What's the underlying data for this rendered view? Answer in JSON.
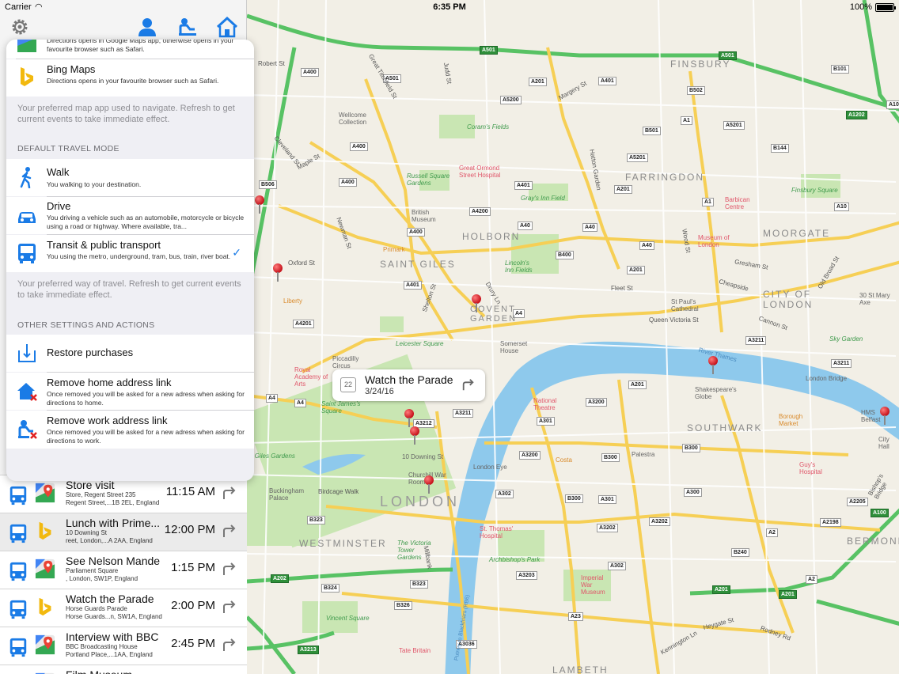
{
  "status": {
    "carrier": "Carrier",
    "time": "6:35 PM",
    "battery": "100%"
  },
  "toolbar": {
    "settings_icon": "gear-icon",
    "profile_icon": "person-icon",
    "work_icon": "person-desk-icon",
    "home_icon": "home-icon"
  },
  "popover": {
    "google_sub": "Directions opens in Google Maps app, otherwise opens in your favourite browser such as Safari.",
    "bing": {
      "title": "Bing Maps",
      "sub": "Directions opens in your favourite browser such as Safari."
    },
    "map_footer": "Your preferred map app used to navigate. Refresh to get current events to take immediate effect.",
    "travel_header": "DEFAULT TRAVEL MODE",
    "modes": [
      {
        "title": "Walk",
        "sub": "You walking to your destination.",
        "icon": "walk-icon"
      },
      {
        "title": "Drive",
        "sub": "You driving a vehicle such as an automobile, motorcycle or bicycle using a road or highway. Where available, tra...",
        "icon": "car-icon"
      },
      {
        "title": "Transit & public transport",
        "sub": "You using the metro, underground, tram, bus, train, river boat.",
        "icon": "bus-icon"
      }
    ],
    "selected_mode": "Transit & public transport",
    "travel_footer": "Your preferred way of travel. Refresh to get current events to take immediate effect.",
    "other_header": "OTHER SETTINGS AND ACTIONS",
    "restore": "Restore purchases",
    "remove_home": {
      "title": "Remove home address link",
      "sub": "Once removed you will be asked for a new adress when asking for directions to home."
    },
    "remove_work": {
      "title": "Remove work address link",
      "sub": "Once removed you will be asked for a new adress when asking for directions to work."
    }
  },
  "events": [
    {
      "title": "Store visit",
      "l1": "Store, Regent Street 235",
      "l2": "Regent Street,...1B 2EL, England",
      "time": "11:15 AM",
      "map": "google"
    },
    {
      "title": "Lunch with Prime...",
      "l1": "10 Downing St",
      "l2": "reet, London,...A 2AA, England",
      "time": "12:00 PM",
      "map": "bing"
    },
    {
      "title": "See Nelson Mandela",
      "l1": "Parliament Square",
      "l2": ", London, SW1P, England",
      "time": "1:15 PM",
      "map": "google"
    },
    {
      "title": "Watch the Parade",
      "l1": "Horse Guards Parade",
      "l2": "Horse Guards...n, SW1A, England",
      "time": "2:00 PM",
      "map": "bing"
    },
    {
      "title": "Interview with BBC",
      "l1": "BBC Broadcasting House",
      "l2": "Portland Place,...1AA, England",
      "time": "2:45 PM",
      "map": "google"
    },
    {
      "title": "Film Museum",
      "l1": "",
      "l2": "",
      "time": "",
      "map": "google"
    }
  ],
  "callout": {
    "title": "Watch the Parade",
    "date": "3/24/16",
    "day": "22"
  },
  "map": {
    "areas": [
      "FINSBURY",
      "HOLBORN",
      "SAINT GILES",
      "COVENT GARDEN",
      "FARRINGDON",
      "MOORGATE",
      "CITY OF LONDON",
      "SOUTHWARK",
      "LONDON",
      "WESTMINSTER",
      "BERMONDSE",
      "LAMBETH"
    ],
    "pois": [
      "Russell Square Gardens",
      "Gray's Inn Field",
      "Lincoln's Inn Fields",
      "Coram's Fields",
      "Great Ormond Street Hospital",
      "Wellcome Collection",
      "British Museum",
      "Barbican Centre",
      "Finsbury Square",
      "Museum of London",
      "Primark",
      "Leicester Square",
      "Royal Academy of Arts",
      "St Paul's Cathedral",
      "Shakespeare's Globe",
      "National Theatre",
      "Borough Market",
      "Guy's Hospital",
      "London Eye",
      "St. Thomas' Hospital",
      "The Victoria Tower Gardens",
      "Archbishop's Park",
      "Imperial War Museum",
      "Churchill War Rooms",
      "Buckingham Palace",
      "Tate Britain",
      "Vincent Square",
      "Saint James's Square",
      "Piccadilly Circus",
      "Somerset House",
      "Costa",
      "Palestra",
      "St Giles Gardens",
      "HMS Belfast",
      "City Hall",
      "30 St Mary Axe",
      "Sky Garden",
      "London Bridge",
      "Liberty",
      "10 Downing St",
      "Birdcage Walk",
      "Oxford St",
      "Cleveland St",
      "Maple St",
      "Newman St",
      "Judd St",
      "Robert St",
      "Drury Ln",
      "Shelton St",
      "Cannon St",
      "Queen Victoria St",
      "Cheapside",
      "Gresham St",
      "River Thames",
      "Old Broad St",
      "Wood St",
      "Fleet St",
      "Hatton Garden",
      "Great Titchfield St",
      "Margery St",
      "Rodney Rd",
      "Heygate St",
      "Kennington Ln",
      "Bishop's Bridge",
      "Millbank",
      "Putney to Blackfriars (RB6)"
    ]
  },
  "colors": {
    "accent": "#1a7be6",
    "pin": "#d41c24",
    "park": "#c9e6b3",
    "water": "#8ec9ec",
    "major_road": "#f9d86a",
    "green_road": "#58c264"
  }
}
